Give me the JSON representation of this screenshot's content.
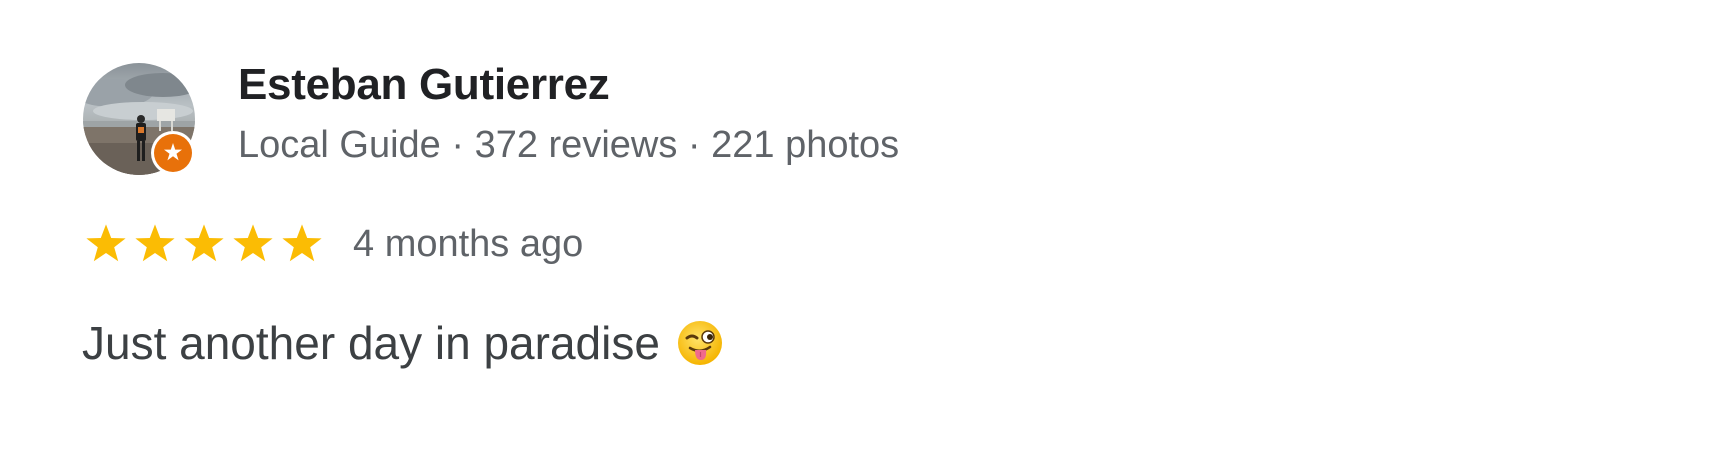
{
  "reviewer": {
    "name": "Esteban Gutierrez",
    "meta": "Local Guide · 372 reviews · 221 photos",
    "is_local_guide": true
  },
  "rating": {
    "stars": 5,
    "max_stars": 5,
    "time": "4 months ago"
  },
  "review": {
    "text": "Just another day in paradise",
    "emoji": "winking-face-with-tongue"
  },
  "colors": {
    "star": "#fbbc04",
    "badge": "#e8710a",
    "name": "#202124",
    "meta": "#5f6368",
    "body": "#3c4043"
  },
  "icons": {
    "avatar": "beach-photo-avatar",
    "badge": "local-guide-badge-icon",
    "star": "star-icon",
    "emoji": "winking-face-with-tongue-emoji-icon"
  }
}
